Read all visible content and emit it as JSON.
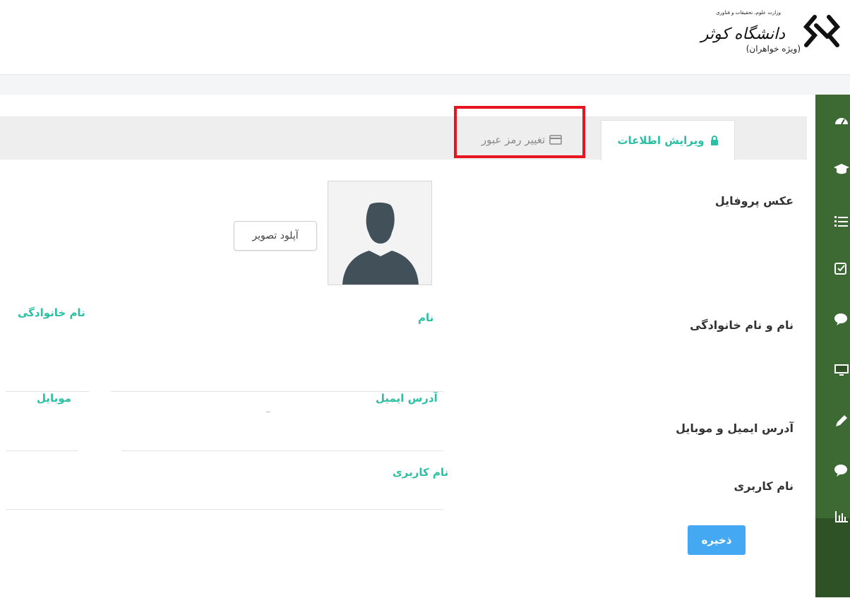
{
  "header": {
    "logo": {
      "ministry_text": "وزارت علوم، تحقیقات و فناوری",
      "university_name": "دانشگاه کوثر",
      "subtitle": "(ویژه خواهران)"
    }
  },
  "sidebar": {
    "icons": [
      "dashboard-icon",
      "graduation-cap-icon",
      "list-icon",
      "checkbox-icon",
      "comments-icon",
      "monitor-icon",
      "pencil-icon",
      "comments-icon",
      "bar-chart-icon"
    ]
  },
  "tabs": {
    "edit_info": "ویرایش اطلاعات",
    "change_password": "تغییر رمز عبور"
  },
  "colors": {
    "accent": "#2bbfa3",
    "sidebar": "#3d6a33",
    "save_button": "#44a9f2",
    "highlight": "#e8141f"
  },
  "form": {
    "profile_photo_label": "عکس پروفایل",
    "upload_button": "آپلود تصویر",
    "name_section_label": "نام و نام خانوادگی",
    "first_name_label": "نام",
    "last_name_label": "نام خانوادگی",
    "contact_section_label": "آدرس ایمیل و موبایل",
    "email_label": "آدرس ایمیل",
    "mobile_label": "موبایل",
    "username_section_label": "نام کاربری",
    "username_label": "نام کاربری",
    "save_button": "ذخیره"
  }
}
